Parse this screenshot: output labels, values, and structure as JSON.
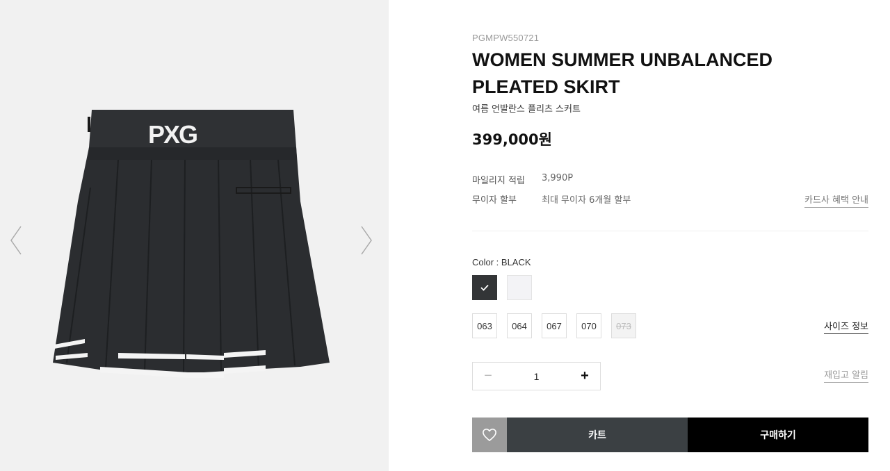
{
  "product": {
    "code": "PGMPW550721",
    "title": "WOMEN SUMMER UNBALANCED PLEATED SKIRT",
    "subtitle": "여름 언발란스 플리츠 스커트",
    "price": "399,000원",
    "image_alt": "PXG black pleated skirt"
  },
  "gallery": {
    "logo_text": "PXG",
    "prev_icon": "chevron-left-icon",
    "next_icon": "chevron-right-icon"
  },
  "meta": {
    "mileage_label": "마일리지 적립",
    "mileage_value": "3,990P",
    "installment_label": "무이자 할부",
    "installment_value": "최대 무이자 6개월 할부",
    "card_benefit_link": "카드사 혜택 안내"
  },
  "options": {
    "color_label": "Color : BLACK",
    "colors": [
      {
        "name": "BLACK",
        "hex": "#333537",
        "selected": true
      },
      {
        "name": "WHITE",
        "hex": "#f3f3f6",
        "selected": false
      }
    ],
    "sizes": [
      {
        "label": "063",
        "soldout": false
      },
      {
        "label": "064",
        "soldout": false
      },
      {
        "label": "067",
        "soldout": false
      },
      {
        "label": "070",
        "soldout": false
      },
      {
        "label": "073",
        "soldout": true
      }
    ],
    "size_guide_link": "사이즈 정보"
  },
  "quantity": {
    "minus": "−",
    "value": "1",
    "plus": "+",
    "restock_link": "재입고 알림"
  },
  "actions": {
    "wishlist_icon": "heart-icon",
    "cart_label": "카트",
    "buy_label": "구매하기"
  },
  "colors": {
    "gallery_bg": "#f1f1f1",
    "cart_bg": "#3b4043",
    "buy_bg": "#000000",
    "wish_bg": "#9b9b9b"
  }
}
